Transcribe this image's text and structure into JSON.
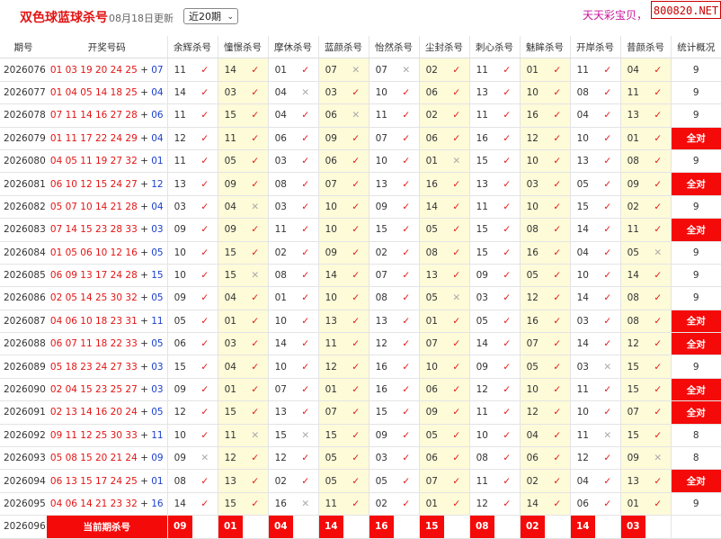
{
  "header": {
    "title": "双色球蓝球杀号",
    "updated": "08月18日更新",
    "period_select": "近20期",
    "slogan": "天天彩宝贝，",
    "brand": "800820.NET"
  },
  "columns": {
    "issue": "期号",
    "draw": "开奖号码",
    "methods": [
      "余辉杀号",
      "憧憬杀号",
      "摩休杀号",
      "蓝颜杀号",
      "怡然杀号",
      "尘封杀号",
      "刺心杀号",
      "魅眸杀号",
      "开岸杀号",
      "昔颜杀号"
    ],
    "stat": "统计概况"
  },
  "rows": [
    {
      "issue": "2026076",
      "red": "01 03 19 20 24 25",
      "blue": "07",
      "kills": [
        [
          "11",
          1
        ],
        [
          "14",
          1
        ],
        [
          "01",
          1
        ],
        [
          "07",
          0
        ],
        [
          "07",
          0
        ],
        [
          "02",
          1
        ],
        [
          "11",
          1
        ],
        [
          "01",
          1
        ],
        [
          "11",
          1
        ],
        [
          "04",
          1
        ]
      ],
      "stat": "9"
    },
    {
      "issue": "2026077",
      "red": "01 04 05 14 18 25",
      "blue": "04",
      "kills": [
        [
          "14",
          1
        ],
        [
          "03",
          1
        ],
        [
          "04",
          0
        ],
        [
          "03",
          1
        ],
        [
          "10",
          1
        ],
        [
          "06",
          1
        ],
        [
          "13",
          1
        ],
        [
          "10",
          1
        ],
        [
          "08",
          1
        ],
        [
          "11",
          1
        ]
      ],
      "stat": "9"
    },
    {
      "issue": "2026078",
      "red": "07 11 14 16 27 28",
      "blue": "06",
      "kills": [
        [
          "11",
          1
        ],
        [
          "15",
          1
        ],
        [
          "04",
          1
        ],
        [
          "06",
          0
        ],
        [
          "11",
          1
        ],
        [
          "02",
          1
        ],
        [
          "11",
          1
        ],
        [
          "16",
          1
        ],
        [
          "04",
          1
        ],
        [
          "13",
          1
        ]
      ],
      "stat": "9"
    },
    {
      "issue": "2026079",
      "red": "01 11 17 22 24 29",
      "blue": "04",
      "kills": [
        [
          "12",
          1
        ],
        [
          "11",
          1
        ],
        [
          "06",
          1
        ],
        [
          "09",
          1
        ],
        [
          "07",
          1
        ],
        [
          "06",
          1
        ],
        [
          "16",
          1
        ],
        [
          "12",
          1
        ],
        [
          "10",
          1
        ],
        [
          "01",
          1
        ]
      ],
      "stat": "全对"
    },
    {
      "issue": "2026080",
      "red": "04 05 11 19 27 32",
      "blue": "01",
      "kills": [
        [
          "11",
          1
        ],
        [
          "05",
          1
        ],
        [
          "03",
          1
        ],
        [
          "06",
          1
        ],
        [
          "10",
          1
        ],
        [
          "01",
          0
        ],
        [
          "15",
          1
        ],
        [
          "10",
          1
        ],
        [
          "13",
          1
        ],
        [
          "08",
          1
        ]
      ],
      "stat": "9"
    },
    {
      "issue": "2026081",
      "red": "06 10 12 15 24 27",
      "blue": "12",
      "kills": [
        [
          "13",
          1
        ],
        [
          "09",
          1
        ],
        [
          "08",
          1
        ],
        [
          "07",
          1
        ],
        [
          "13",
          1
        ],
        [
          "16",
          1
        ],
        [
          "13",
          1
        ],
        [
          "03",
          1
        ],
        [
          "05",
          1
        ],
        [
          "09",
          1
        ]
      ],
      "stat": "全对"
    },
    {
      "issue": "2026082",
      "red": "05 07 10 14 21 28",
      "blue": "04",
      "kills": [
        [
          "03",
          1
        ],
        [
          "04",
          0
        ],
        [
          "03",
          1
        ],
        [
          "10",
          1
        ],
        [
          "09",
          1
        ],
        [
          "14",
          1
        ],
        [
          "11",
          1
        ],
        [
          "10",
          1
        ],
        [
          "15",
          1
        ],
        [
          "02",
          1
        ]
      ],
      "stat": "9"
    },
    {
      "issue": "2026083",
      "red": "07 14 15 23 28 33",
      "blue": "03",
      "kills": [
        [
          "09",
          1
        ],
        [
          "09",
          1
        ],
        [
          "11",
          1
        ],
        [
          "10",
          1
        ],
        [
          "15",
          1
        ],
        [
          "05",
          1
        ],
        [
          "15",
          1
        ],
        [
          "08",
          1
        ],
        [
          "14",
          1
        ],
        [
          "11",
          1
        ]
      ],
      "stat": "全对"
    },
    {
      "issue": "2026084",
      "red": "01 05 06 10 12 16",
      "blue": "05",
      "kills": [
        [
          "10",
          1
        ],
        [
          "15",
          1
        ],
        [
          "02",
          1
        ],
        [
          "09",
          1
        ],
        [
          "02",
          1
        ],
        [
          "08",
          1
        ],
        [
          "15",
          1
        ],
        [
          "16",
          1
        ],
        [
          "04",
          1
        ],
        [
          "05",
          0
        ]
      ],
      "stat": "9"
    },
    {
      "issue": "2026085",
      "red": "06 09 13 17 24 28",
      "blue": "15",
      "kills": [
        [
          "10",
          1
        ],
        [
          "15",
          0
        ],
        [
          "08",
          1
        ],
        [
          "14",
          1
        ],
        [
          "07",
          1
        ],
        [
          "13",
          1
        ],
        [
          "09",
          1
        ],
        [
          "05",
          1
        ],
        [
          "10",
          1
        ],
        [
          "14",
          1
        ]
      ],
      "stat": "9"
    },
    {
      "issue": "2026086",
      "red": "02 05 14 25 30 32",
      "blue": "05",
      "kills": [
        [
          "09",
          1
        ],
        [
          "04",
          1
        ],
        [
          "01",
          1
        ],
        [
          "10",
          1
        ],
        [
          "08",
          1
        ],
        [
          "05",
          0
        ],
        [
          "03",
          1
        ],
        [
          "12",
          1
        ],
        [
          "14",
          1
        ],
        [
          "08",
          1
        ]
      ],
      "stat": "9"
    },
    {
      "issue": "2026087",
      "red": "04 06 10 18 23 31",
      "blue": "11",
      "kills": [
        [
          "05",
          1
        ],
        [
          "01",
          1
        ],
        [
          "10",
          1
        ],
        [
          "13",
          1
        ],
        [
          "13",
          1
        ],
        [
          "01",
          1
        ],
        [
          "05",
          1
        ],
        [
          "16",
          1
        ],
        [
          "03",
          1
        ],
        [
          "08",
          1
        ]
      ],
      "stat": "全对"
    },
    {
      "issue": "2026088",
      "red": "06 07 11 18 22 33",
      "blue": "05",
      "kills": [
        [
          "06",
          1
        ],
        [
          "03",
          1
        ],
        [
          "14",
          1
        ],
        [
          "11",
          1
        ],
        [
          "12",
          1
        ],
        [
          "07",
          1
        ],
        [
          "14",
          1
        ],
        [
          "07",
          1
        ],
        [
          "14",
          1
        ],
        [
          "12",
          1
        ]
      ],
      "stat": "全对"
    },
    {
      "issue": "2026089",
      "red": "05 18 23 24 27 33",
      "blue": "03",
      "kills": [
        [
          "15",
          1
        ],
        [
          "04",
          1
        ],
        [
          "10",
          1
        ],
        [
          "12",
          1
        ],
        [
          "16",
          1
        ],
        [
          "10",
          1
        ],
        [
          "09",
          1
        ],
        [
          "05",
          1
        ],
        [
          "03",
          0
        ],
        [
          "15",
          1
        ]
      ],
      "stat": "9"
    },
    {
      "issue": "2026090",
      "red": "02 04 15 23 25 27",
      "blue": "03",
      "kills": [
        [
          "09",
          1
        ],
        [
          "01",
          1
        ],
        [
          "07",
          1
        ],
        [
          "01",
          1
        ],
        [
          "16",
          1
        ],
        [
          "06",
          1
        ],
        [
          "12",
          1
        ],
        [
          "10",
          1
        ],
        [
          "11",
          1
        ],
        [
          "15",
          1
        ]
      ],
      "stat": "全对"
    },
    {
      "issue": "2026091",
      "red": "02 13 14 16 20 24",
      "blue": "05",
      "kills": [
        [
          "12",
          1
        ],
        [
          "15",
          1
        ],
        [
          "13",
          1
        ],
        [
          "07",
          1
        ],
        [
          "15",
          1
        ],
        [
          "09",
          1
        ],
        [
          "11",
          1
        ],
        [
          "12",
          1
        ],
        [
          "10",
          1
        ],
        [
          "07",
          1
        ]
      ],
      "stat": "全对"
    },
    {
      "issue": "2026092",
      "red": "09 11 12 25 30 33",
      "blue": "11",
      "kills": [
        [
          "10",
          1
        ],
        [
          "11",
          0
        ],
        [
          "15",
          0
        ],
        [
          "15",
          1
        ],
        [
          "09",
          1
        ],
        [
          "05",
          1
        ],
        [
          "10",
          1
        ],
        [
          "04",
          1
        ],
        [
          "11",
          0
        ],
        [
          "15",
          1
        ]
      ],
      "stat": "8"
    },
    {
      "issue": "2026093",
      "red": "05 08 15 20 21 24",
      "blue": "09",
      "kills": [
        [
          "09",
          0
        ],
        [
          "12",
          1
        ],
        [
          "12",
          1
        ],
        [
          "05",
          1
        ],
        [
          "03",
          1
        ],
        [
          "06",
          1
        ],
        [
          "08",
          1
        ],
        [
          "06",
          1
        ],
        [
          "12",
          1
        ],
        [
          "09",
          0
        ]
      ],
      "stat": "8"
    },
    {
      "issue": "2026094",
      "red": "06 13 15 17 24 25",
      "blue": "01",
      "kills": [
        [
          "08",
          1
        ],
        [
          "13",
          1
        ],
        [
          "02",
          1
        ],
        [
          "05",
          1
        ],
        [
          "05",
          1
        ],
        [
          "07",
          1
        ],
        [
          "11",
          1
        ],
        [
          "02",
          1
        ],
        [
          "04",
          1
        ],
        [
          "13",
          1
        ]
      ],
      "stat": "全对"
    },
    {
      "issue": "2026095",
      "red": "04 06 14 21 23 32",
      "blue": "16",
      "kills": [
        [
          "14",
          1
        ],
        [
          "15",
          1
        ],
        [
          "16",
          0
        ],
        [
          "11",
          1
        ],
        [
          "02",
          1
        ],
        [
          "01",
          1
        ],
        [
          "12",
          1
        ],
        [
          "14",
          1
        ],
        [
          "06",
          1
        ],
        [
          "01",
          1
        ]
      ],
      "stat": "9"
    }
  ],
  "current": {
    "issue": "2026096",
    "label": "当前期杀号",
    "kills": [
      "09",
      "01",
      "04",
      "14",
      "16",
      "15",
      "08",
      "02",
      "14",
      "03"
    ]
  },
  "symbols": {
    "ok": "✓",
    "no": "✕"
  },
  "colors": {
    "red": "#e31414",
    "blue": "#1a3fd0",
    "highlight": "#f50a0a",
    "column_tint": "#fdfbd8"
  }
}
